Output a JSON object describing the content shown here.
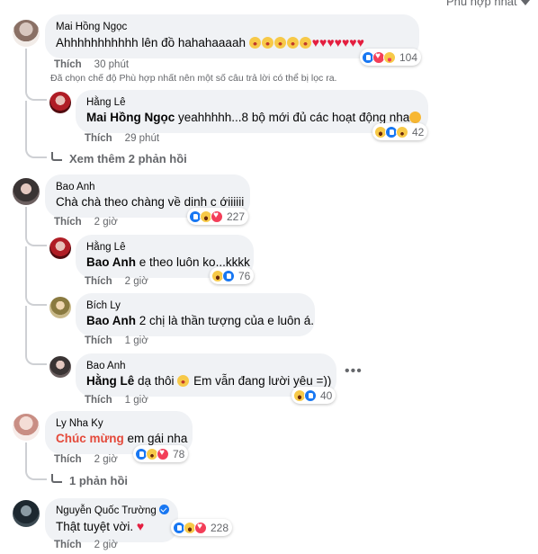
{
  "sort": {
    "label": "Phù hợp nhất"
  },
  "filter_note": "Đã chọn chế độ Phù hợp nhất nên một số câu trả lời có thể bị lọc ra.",
  "like_label": "Thích",
  "comments": [
    {
      "author": "Mai Hồng Ngọc",
      "text": "Ahhhhhhhhhhh lên đồ hahahaaaah",
      "time": "30 phút",
      "reaction_count": "104"
    },
    {
      "author": "Hằng Lê",
      "mention": "Mai Hồng Ngọc",
      "text": " yeahhhhh...8 bộ mới đủ các hoạt động nha",
      "time": "29 phút",
      "reaction_count": "42"
    },
    {
      "more_replies": "Xem thêm 2 phản hồi"
    },
    {
      "author": "Bao Anh",
      "text": "Chà chà theo chàng về dinh c ớiiiiii",
      "time": "2 giờ",
      "reaction_count": "227"
    },
    {
      "author": "Hằng Lê",
      "mention": "Bao Anh",
      "text": " e theo luôn ko...kkkk",
      "time": "2 giờ",
      "reaction_count": "76"
    },
    {
      "author": "Bích Ly",
      "mention": "Bao Anh",
      "text": " 2 chị là thần tượng của e luôn á.",
      "time": "1 giờ"
    },
    {
      "author": "Bao Anh",
      "mention": "Hằng Lê",
      "text_a": " dạ thôi ",
      "text_b": " Em vẫn đang lười yêu =))",
      "time": "1 giờ",
      "reaction_count": "40"
    },
    {
      "author": "Ly Nha Ky",
      "mention": "Chúc mừng",
      "text": " em gái nha",
      "time": "2 giờ",
      "reaction_count": "78"
    },
    {
      "more_replies": "1 phản hồi"
    },
    {
      "author": "Nguyễn Quốc Trường",
      "text": "Thật tuyệt vời.",
      "time": "2 giờ",
      "reaction_count": "228"
    }
  ],
  "icons": {
    "options": "more-options-icon",
    "verified": "verified-badge-icon"
  },
  "colors": {
    "bubble_bg": "#f0f2f5",
    "meta_text": "#65676b",
    "like_blue": "#1877f2",
    "love_red": "#f33e58",
    "mention_red": "#e4493a"
  }
}
